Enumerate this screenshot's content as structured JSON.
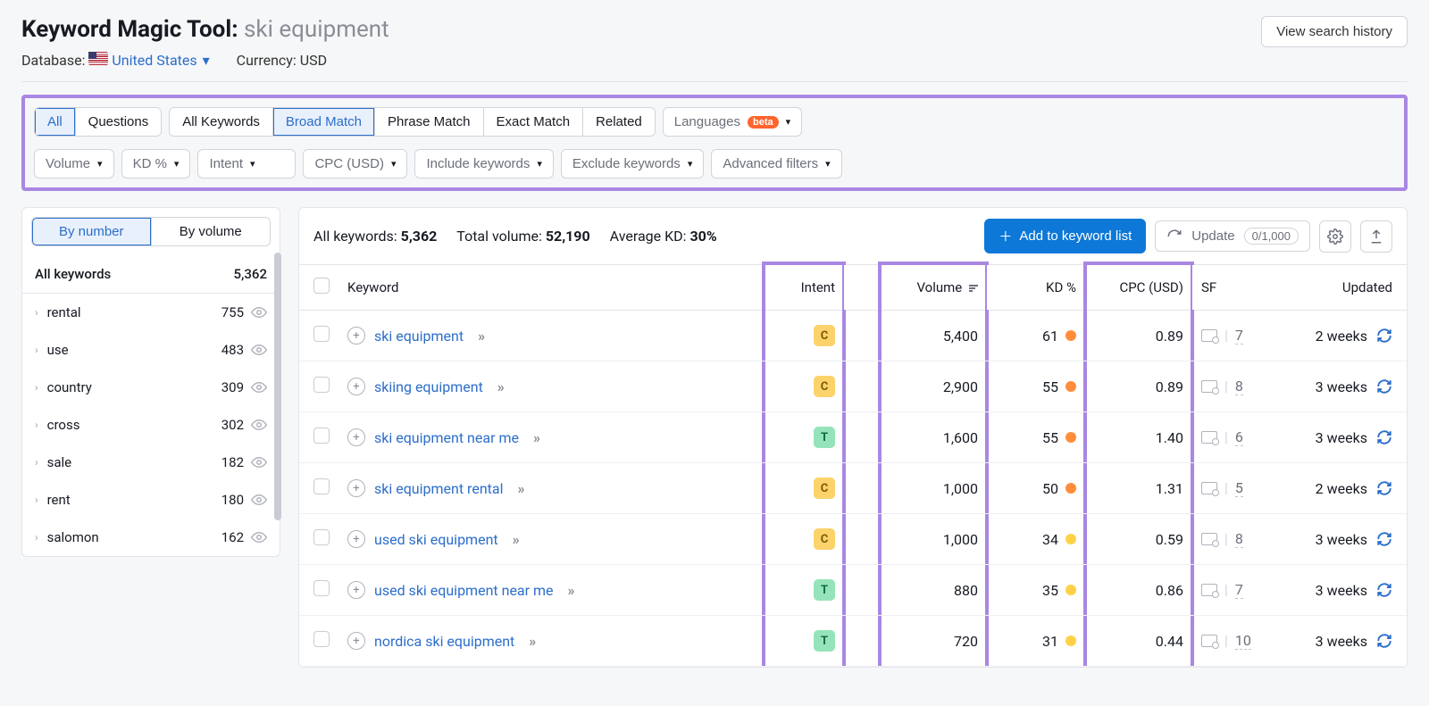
{
  "header": {
    "title": "Keyword Magic Tool:",
    "query": "ski equipment",
    "database_label": "Database:",
    "database_value": "United States",
    "currency_label": "Currency:",
    "currency_value": "USD",
    "history_button": "View search history"
  },
  "filters": {
    "seg1": [
      "All",
      "Questions"
    ],
    "seg1_active": 0,
    "seg2": [
      "All Keywords",
      "Broad Match",
      "Phrase Match",
      "Exact Match",
      "Related"
    ],
    "seg2_active": 1,
    "languages": "Languages",
    "beta": "beta",
    "row2": [
      "Volume",
      "KD %",
      "Intent",
      "CPC (USD)",
      "Include keywords",
      "Exclude keywords",
      "Advanced filters"
    ]
  },
  "sidebar": {
    "seg": [
      "By number",
      "By volume"
    ],
    "seg_active": 0,
    "all_label": "All keywords",
    "all_count": "5,362",
    "groups": [
      {
        "name": "rental",
        "count": "755"
      },
      {
        "name": "use",
        "count": "483"
      },
      {
        "name": "country",
        "count": "309"
      },
      {
        "name": "cross",
        "count": "302"
      },
      {
        "name": "sale",
        "count": "182"
      },
      {
        "name": "rent",
        "count": "180"
      },
      {
        "name": "salomon",
        "count": "162"
      }
    ]
  },
  "main": {
    "stats": {
      "all_keywords_label": "All keywords:",
      "all_keywords_value": "5,362",
      "total_volume_label": "Total volume:",
      "total_volume_value": "52,190",
      "avg_kd_label": "Average KD:",
      "avg_kd_value": "30%"
    },
    "add_button": "Add to keyword list",
    "update_button": "Update",
    "update_count": "0/1,000",
    "columns": {
      "keyword": "Keyword",
      "intent": "Intent",
      "volume": "Volume",
      "kd": "KD %",
      "cpc": "CPC (USD)",
      "sf": "SF",
      "updated": "Updated"
    },
    "rows": [
      {
        "kw": "ski equipment",
        "intent": "C",
        "volume": "5,400",
        "kd": "61",
        "kd_color": "orange",
        "cpc": "0.89",
        "sf": "7",
        "updated": "2 weeks"
      },
      {
        "kw": "skiing equipment",
        "intent": "C",
        "volume": "2,900",
        "kd": "55",
        "kd_color": "orange",
        "cpc": "0.89",
        "sf": "8",
        "updated": "3 weeks"
      },
      {
        "kw": "ski equipment near me",
        "intent": "T",
        "volume": "1,600",
        "kd": "55",
        "kd_color": "orange",
        "cpc": "1.40",
        "sf": "6",
        "updated": "3 weeks"
      },
      {
        "kw": "ski equipment rental",
        "intent": "C",
        "volume": "1,000",
        "kd": "50",
        "kd_color": "orange",
        "cpc": "1.31",
        "sf": "5",
        "updated": "2 weeks"
      },
      {
        "kw": "used ski equipment",
        "intent": "C",
        "volume": "1,000",
        "kd": "34",
        "kd_color": "yellow",
        "cpc": "0.59",
        "sf": "8",
        "updated": "3 weeks"
      },
      {
        "kw": "used ski equipment near me",
        "intent": "T",
        "volume": "880",
        "kd": "35",
        "kd_color": "yellow",
        "cpc": "0.86",
        "sf": "7",
        "updated": "3 weeks"
      },
      {
        "kw": "nordica ski equipment",
        "intent": "T",
        "volume": "720",
        "kd": "31",
        "kd_color": "yellow",
        "cpc": "0.44",
        "sf": "10",
        "updated": "3 weeks"
      }
    ]
  }
}
